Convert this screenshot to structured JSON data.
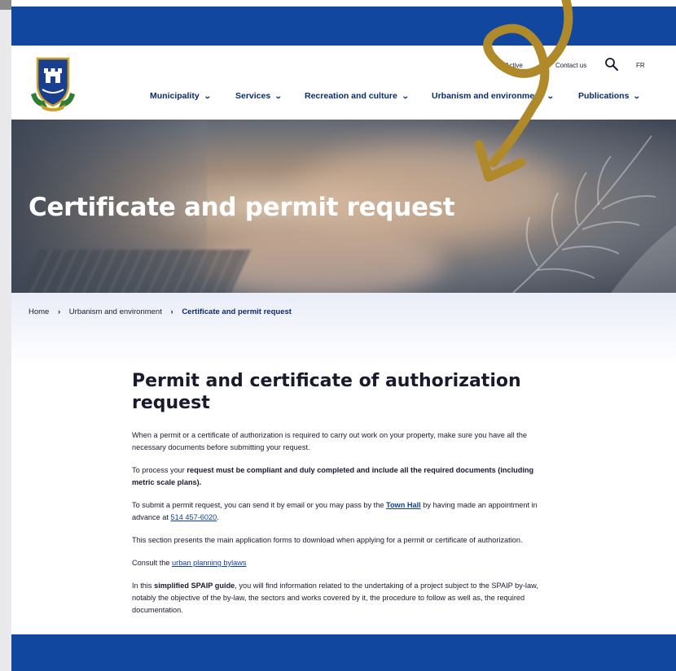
{
  "header": {
    "utility_active": "Active",
    "utility_contact": "Contact us",
    "lang": "FR"
  },
  "nav": {
    "items": [
      {
        "label": "Municipality"
      },
      {
        "label": "Services"
      },
      {
        "label": "Recreation and culture"
      },
      {
        "label": "Urbanism and environment"
      },
      {
        "label": "Publications"
      }
    ]
  },
  "hero": {
    "title": "Certificate and permit request"
  },
  "breadcrumb": {
    "home": "Home",
    "section": "Urbanism and environment",
    "current": "Certificate and permit request",
    "separator": "›"
  },
  "content": {
    "title": "Permit and certificate of authorization request",
    "p1": "When a permit or a certificate of authorization is required to carry out work on your property, make sure you have all the necessary documents before submitting your request.",
    "p2_a": "To process your ",
    "p2_b": "request must be compliant and duly completed and include all the required documents (including metric scale plans).",
    "p3_a": "To submit a permit request, you can send it by email or you may pass by the ",
    "p3_link": "Town Hall",
    "p3_b": " by having made an appointment in advance at ",
    "p3_phone": "514 457-6020",
    "p3_end": ".",
    "p4": "This section presents the main application forms to download when applying for a permit or certificate of authorization.",
    "p5_a": "Consult the ",
    "p5_link": "urban planning bylaws",
    "p6_a": "In this ",
    "p6_bold": "simplified SPAIP guide",
    "p6_b": ", you will find information related to the undertaking of a project subject to the SPAIP by-law, notably the objective of the by-law, the sectors and works covered by it, the procedure to follow as well as, the required documentation."
  },
  "colors": {
    "brand_blue": "#11479e",
    "nav_text": "#0b2a6b",
    "link": "#0f3fa0",
    "arrow": "#b0892a"
  },
  "icons": [
    "municipal-crest-logo",
    "search-icon",
    "chevron-down-icon",
    "annotation-arrow"
  ]
}
